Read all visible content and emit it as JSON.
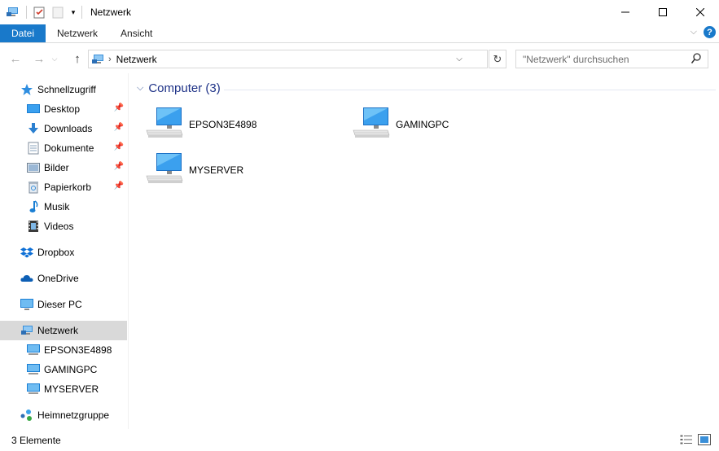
{
  "window": {
    "title": "Netzwerk"
  },
  "ribbon": {
    "tabs": [
      {
        "label": "Datei"
      },
      {
        "label": "Netzwerk"
      },
      {
        "label": "Ansicht"
      }
    ],
    "help": "?"
  },
  "address": {
    "path": "Netzwerk"
  },
  "search": {
    "placeholder": "\"Netzwerk\" durchsuchen"
  },
  "sidebar": {
    "items": [
      {
        "label": "Schnellzugriff",
        "icon": "star-icon"
      },
      {
        "label": "Desktop",
        "icon": "desktop-icon",
        "pinned": true
      },
      {
        "label": "Downloads",
        "icon": "download-icon",
        "pinned": true
      },
      {
        "label": "Dokumente",
        "icon": "document-icon",
        "pinned": true
      },
      {
        "label": "Bilder",
        "icon": "picture-icon",
        "pinned": true
      },
      {
        "label": "Papierkorb",
        "icon": "recycle-bin-icon",
        "pinned": true
      },
      {
        "label": "Musik",
        "icon": "music-icon"
      },
      {
        "label": "Videos",
        "icon": "video-icon"
      },
      {
        "label": "Dropbox",
        "icon": "dropbox-icon"
      },
      {
        "label": "OneDrive",
        "icon": "onedrive-icon"
      },
      {
        "label": "Dieser PC",
        "icon": "pc-icon"
      },
      {
        "label": "Netzwerk",
        "icon": "network-icon",
        "selected": true
      },
      {
        "label": "EPSON3E4898",
        "icon": "computer-icon"
      },
      {
        "label": "GAMINGPC",
        "icon": "computer-icon"
      },
      {
        "label": "MYSERVER",
        "icon": "computer-icon"
      },
      {
        "label": "Heimnetzgruppe",
        "icon": "homegroup-icon"
      }
    ]
  },
  "content": {
    "group_title": "Computer (3)",
    "items": [
      {
        "name": "EPSON3E4898"
      },
      {
        "name": "GAMINGPC"
      },
      {
        "name": "MYSERVER"
      }
    ]
  },
  "status": {
    "count": "3 Elemente"
  },
  "colors": {
    "accent": "#1979ca",
    "selection": "#d9d9d9",
    "group_title": "#1e3287"
  }
}
